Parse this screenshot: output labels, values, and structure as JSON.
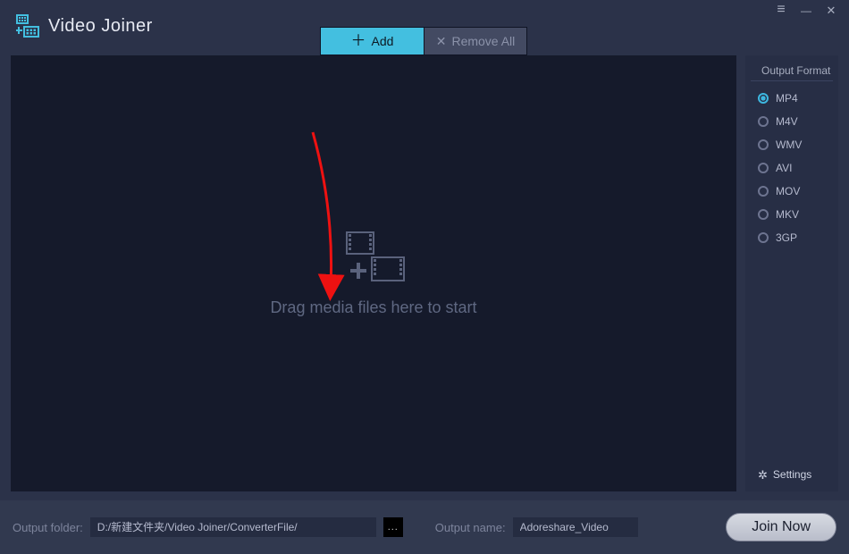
{
  "app": {
    "title": "Video Joiner"
  },
  "toolbar": {
    "add_label": "Add",
    "remove_label": "Remove All"
  },
  "dropzone": {
    "hint": "Drag media files here to start"
  },
  "sidebar": {
    "header": "Output Format",
    "formats": [
      {
        "label": "MP4",
        "selected": true
      },
      {
        "label": "M4V",
        "selected": false
      },
      {
        "label": "WMV",
        "selected": false
      },
      {
        "label": "AVI",
        "selected": false
      },
      {
        "label": "MOV",
        "selected": false
      },
      {
        "label": "MKV",
        "selected": false
      },
      {
        "label": "3GP",
        "selected": false
      }
    ],
    "settings_label": "Settings"
  },
  "footer": {
    "output_folder_label": "Output folder:",
    "output_folder_value": "D:/新建文件夹/Video Joiner/ConverterFile/",
    "browse_label": "...",
    "output_name_label": "Output name:",
    "output_name_value": "Adoreshare_Video",
    "join_label": "Join Now"
  }
}
